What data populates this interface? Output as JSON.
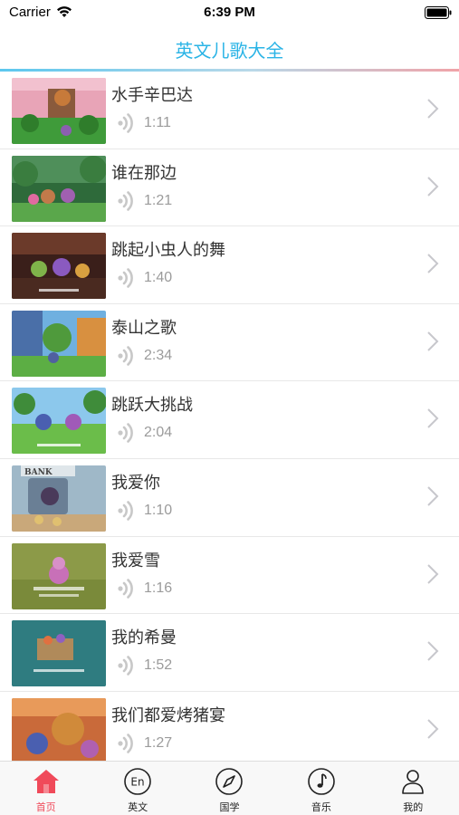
{
  "status_bar": {
    "carrier": "Carrier",
    "time": "6:39 PM"
  },
  "nav": {
    "title": "英文儿歌大全"
  },
  "colors": {
    "accent_blue": "#2bb4e6",
    "active_tab": "#f04a5a",
    "duration_gray": "#9b9b9b"
  },
  "songs": [
    {
      "title": "水手辛巴达",
      "duration": "1:11"
    },
    {
      "title": "谁在那边",
      "duration": "1:21"
    },
    {
      "title": "跳起小虫人的舞",
      "duration": "1:40"
    },
    {
      "title": "泰山之歌",
      "duration": "2:34"
    },
    {
      "title": "跳跃大挑战",
      "duration": "2:04"
    },
    {
      "title": "我爱你",
      "duration": "1:10"
    },
    {
      "title": "我爱雪",
      "duration": "1:16"
    },
    {
      "title": "我的希曼",
      "duration": "1:52"
    },
    {
      "title": "我们都爱烤猪宴",
      "duration": "1:27"
    }
  ],
  "thumb_text": {
    "bank_sign": "BANK"
  },
  "tab_bar": {
    "tabs": [
      {
        "label": "首页",
        "icon": "home-icon",
        "active": true
      },
      {
        "label": "英文",
        "icon": "english-icon",
        "badge": "En",
        "active": false
      },
      {
        "label": "国学",
        "icon": "compass-icon",
        "active": false
      },
      {
        "label": "音乐",
        "icon": "music-note-icon",
        "active": false
      },
      {
        "label": "我的",
        "icon": "person-icon",
        "active": false
      }
    ]
  }
}
